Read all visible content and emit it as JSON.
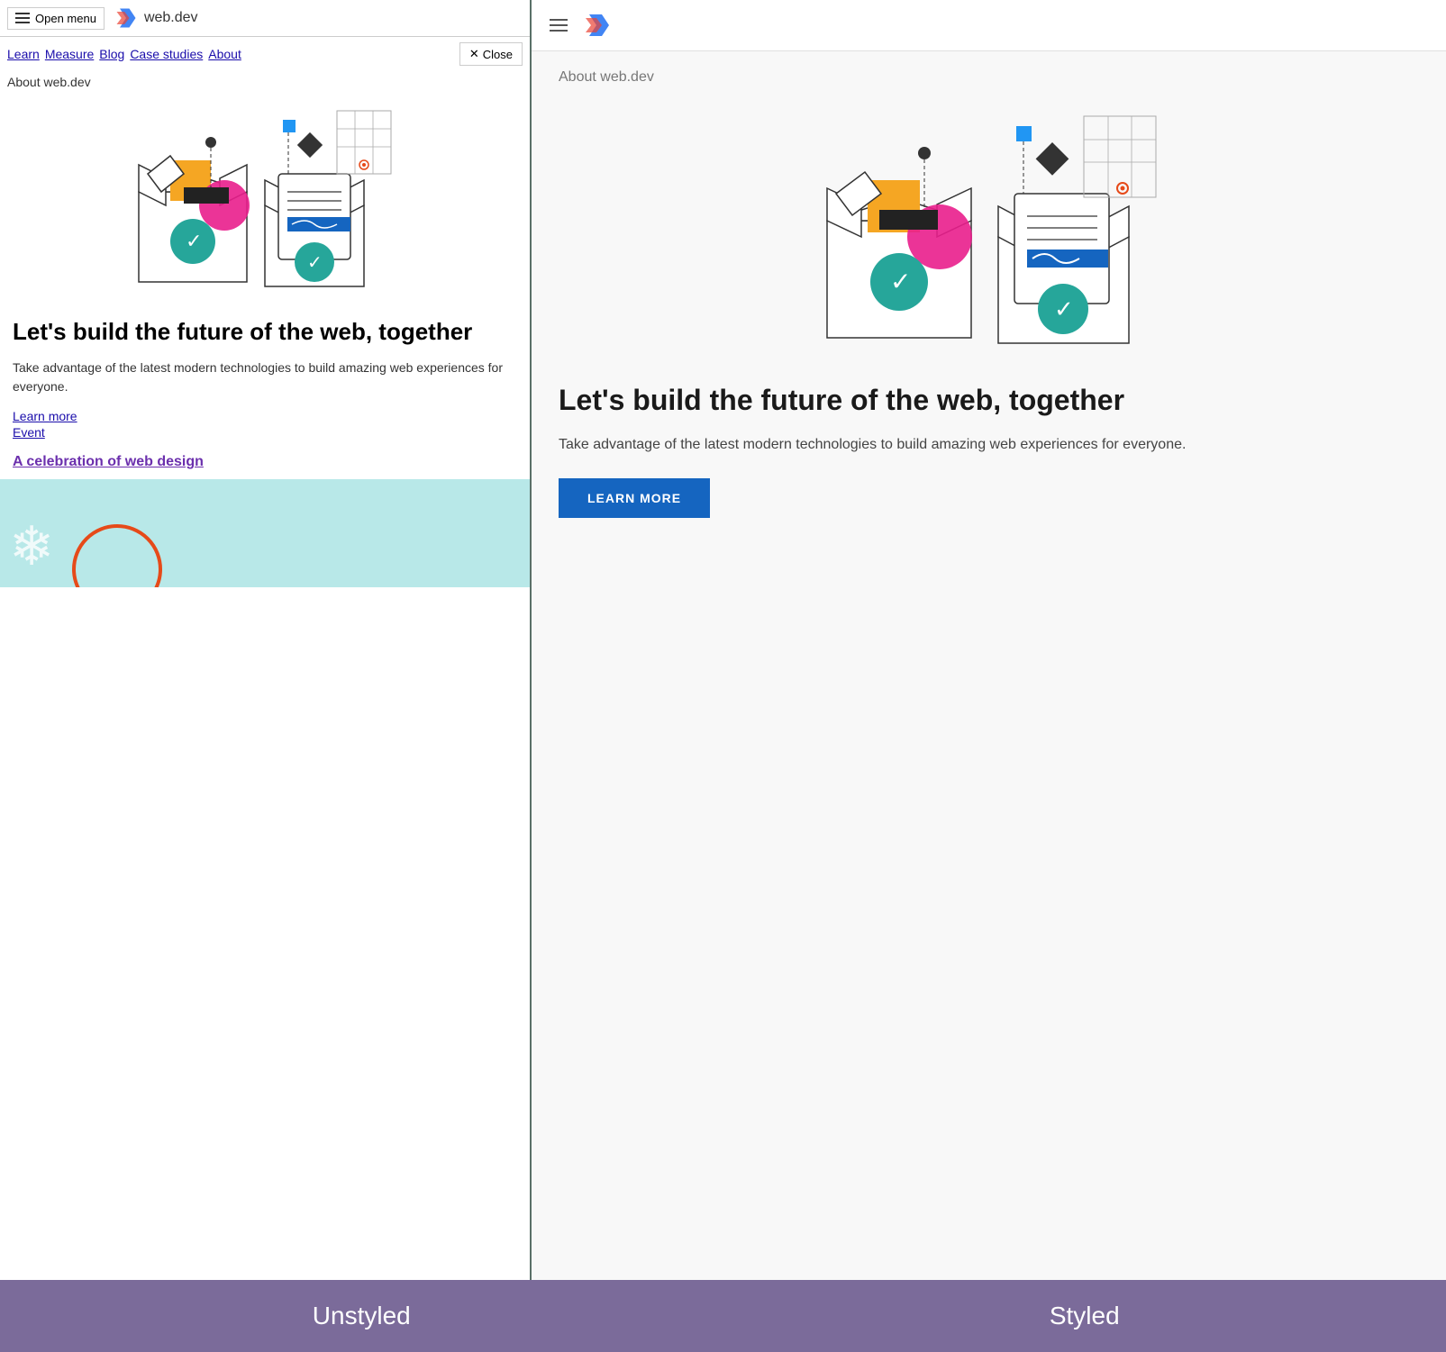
{
  "site": {
    "logo_text": "web.dev",
    "open_menu": "Open menu",
    "close_btn": "✕ Close",
    "nav_links": [
      "Learn",
      "Measure",
      "Blog",
      "Case studies",
      "About"
    ],
    "about_label": "About web.dev"
  },
  "hero": {
    "heading": "Let's build the future of the web, together",
    "subtext": "Take advantage of the latest modern technologies to build amazing web experiences for everyone.",
    "learn_more_link": "Learn more",
    "event_link": "Event",
    "celebration_link": "A celebration of web design",
    "learn_more_btn": "LEARN MORE"
  },
  "labels": {
    "unstyled": "Unstyled",
    "styled": "Styled"
  },
  "colors": {
    "brand_blue": "#1565c0",
    "link_blue": "#1a0dab",
    "purple": "#6b5b8a",
    "teal": "#26a69a"
  }
}
